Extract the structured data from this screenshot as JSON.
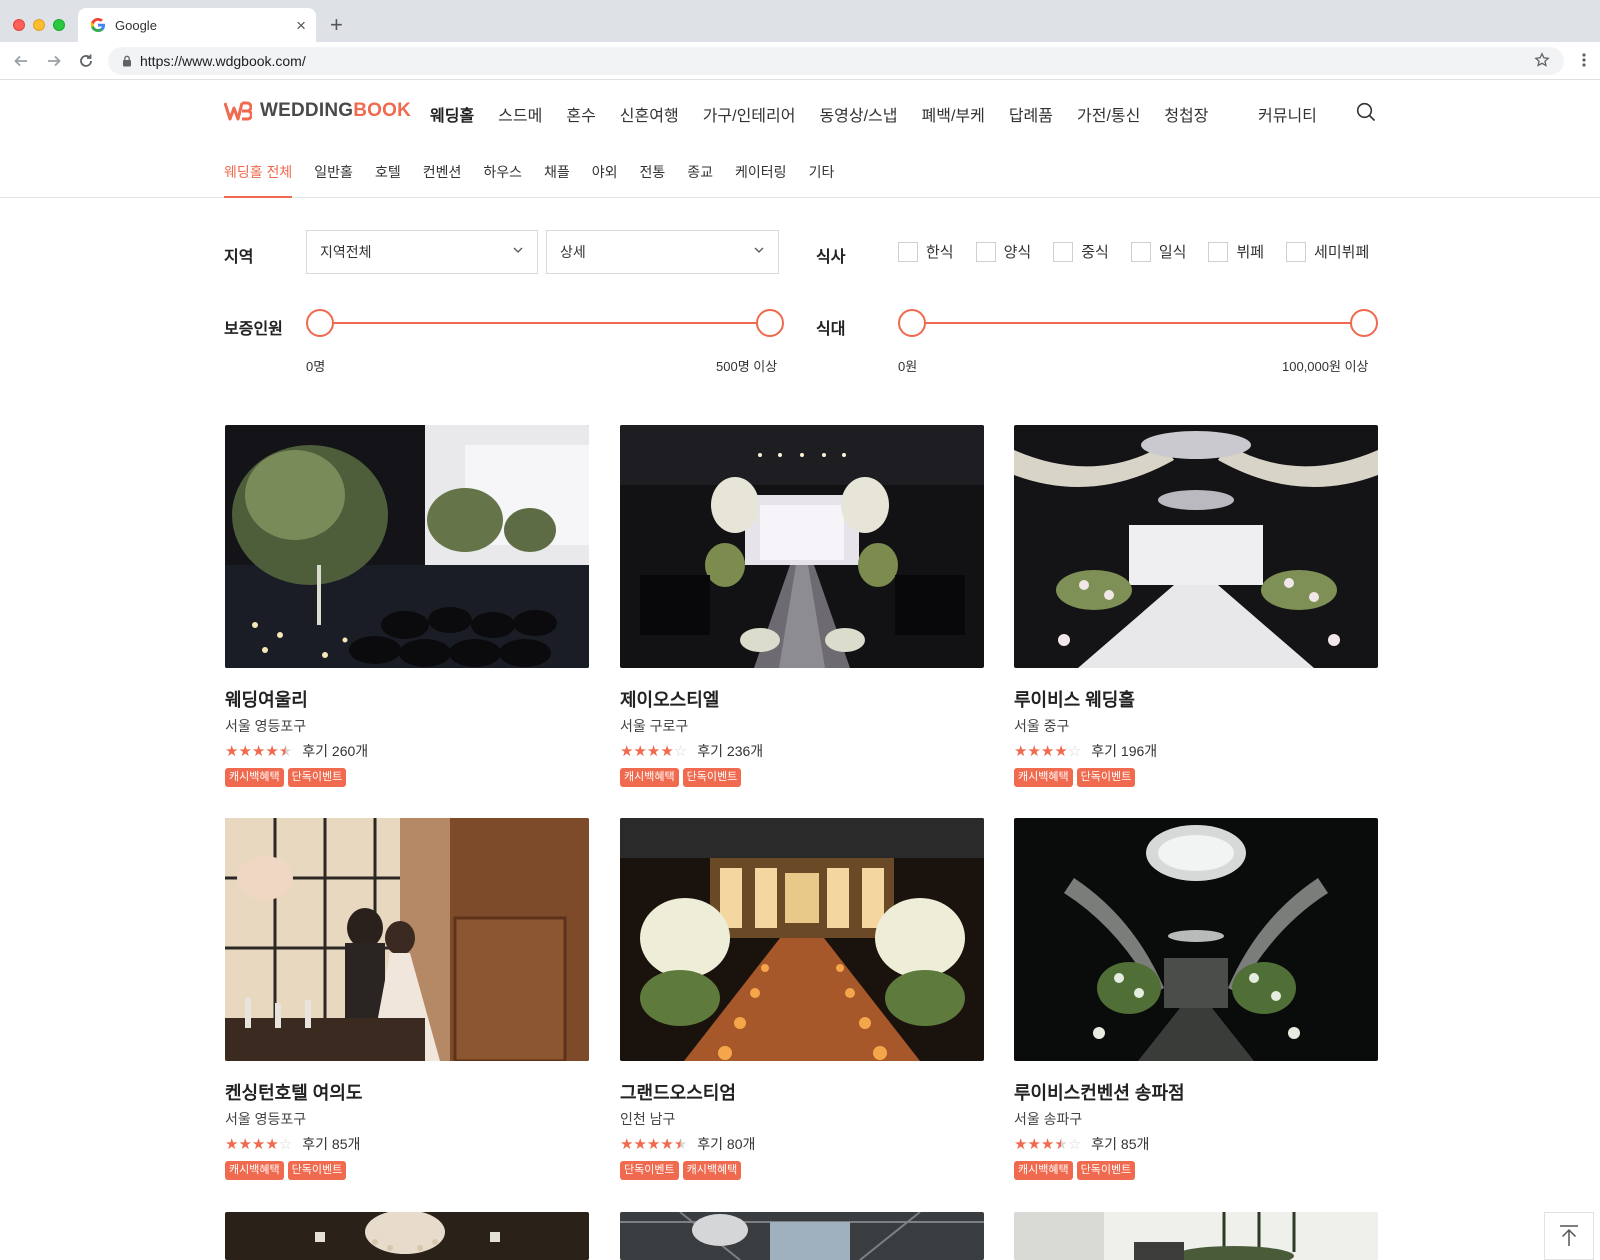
{
  "browser": {
    "tab_title": "Google",
    "url": "https://www.wdgbook.com/"
  },
  "site": {
    "logo_dark": "WEDDING",
    "logo_accent": "BOOK",
    "accent_color": "#ef6a4e",
    "gnb": [
      "웨딩홀",
      "스드메",
      "혼수",
      "신혼여행",
      "가구/인테리어",
      "동영상/스냅",
      "폐백/부케",
      "답례품",
      "가전/통신",
      "청첩장"
    ],
    "community": "커뮤니티",
    "lnb": [
      "웨딩홀 전체",
      "일반홀",
      "호텔",
      "컨벤션",
      "하우스",
      "채플",
      "야외",
      "전통",
      "종교",
      "케이터링",
      "기타"
    ]
  },
  "filters": {
    "region_label": "지역",
    "region_select": "지역전체",
    "detail_select": "상세",
    "meal_label": "식사",
    "meal_options": [
      "한식",
      "양식",
      "중식",
      "일식",
      "뷔페",
      "세미뷔페"
    ],
    "guests_label": "보증인원",
    "guests_min": "0명",
    "guests_max": "500명 이상",
    "price_label": "식대",
    "price_min": "0원",
    "price_max": "100,000원 이상"
  },
  "venues": [
    {
      "name": "웨딩여울리",
      "location": "서울 영등포구",
      "rating": 4.5,
      "reviews": "후기 260개",
      "badges": [
        "캐시백혜택",
        "단독이벤트"
      ]
    },
    {
      "name": "제이오스티엘",
      "location": "서울 구로구",
      "rating": 4,
      "reviews": "후기 236개",
      "badges": [
        "캐시백혜택",
        "단독이벤트"
      ]
    },
    {
      "name": "루이비스 웨딩홀",
      "location": "서울 중구",
      "rating": 4,
      "reviews": "후기 196개",
      "badges": [
        "캐시백혜택",
        "단독이벤트"
      ]
    },
    {
      "name": "켄싱턴호텔 여의도",
      "location": "서울 영등포구",
      "rating": 4,
      "reviews": "후기 85개",
      "badges": [
        "캐시백혜택",
        "단독이벤트"
      ]
    },
    {
      "name": "그랜드오스티엄",
      "location": "인천 남구",
      "rating": 4.5,
      "reviews": "후기 80개",
      "badges": [
        "단독이벤트",
        "캐시백혜택"
      ]
    },
    {
      "name": "루이비스컨벤션 송파점",
      "location": "서울 송파구",
      "rating": 3.5,
      "reviews": "후기 85개",
      "badges": [
        "캐시백혜택",
        "단독이벤트"
      ]
    }
  ],
  "icons": {
    "back": "arrow-left-icon",
    "forward": "arrow-right-icon",
    "reload": "reload-icon",
    "lock": "lock-icon",
    "bookmark": "star-icon",
    "menu": "kebab-icon",
    "search": "search-icon",
    "scroll_top": "scroll-top-icon"
  }
}
